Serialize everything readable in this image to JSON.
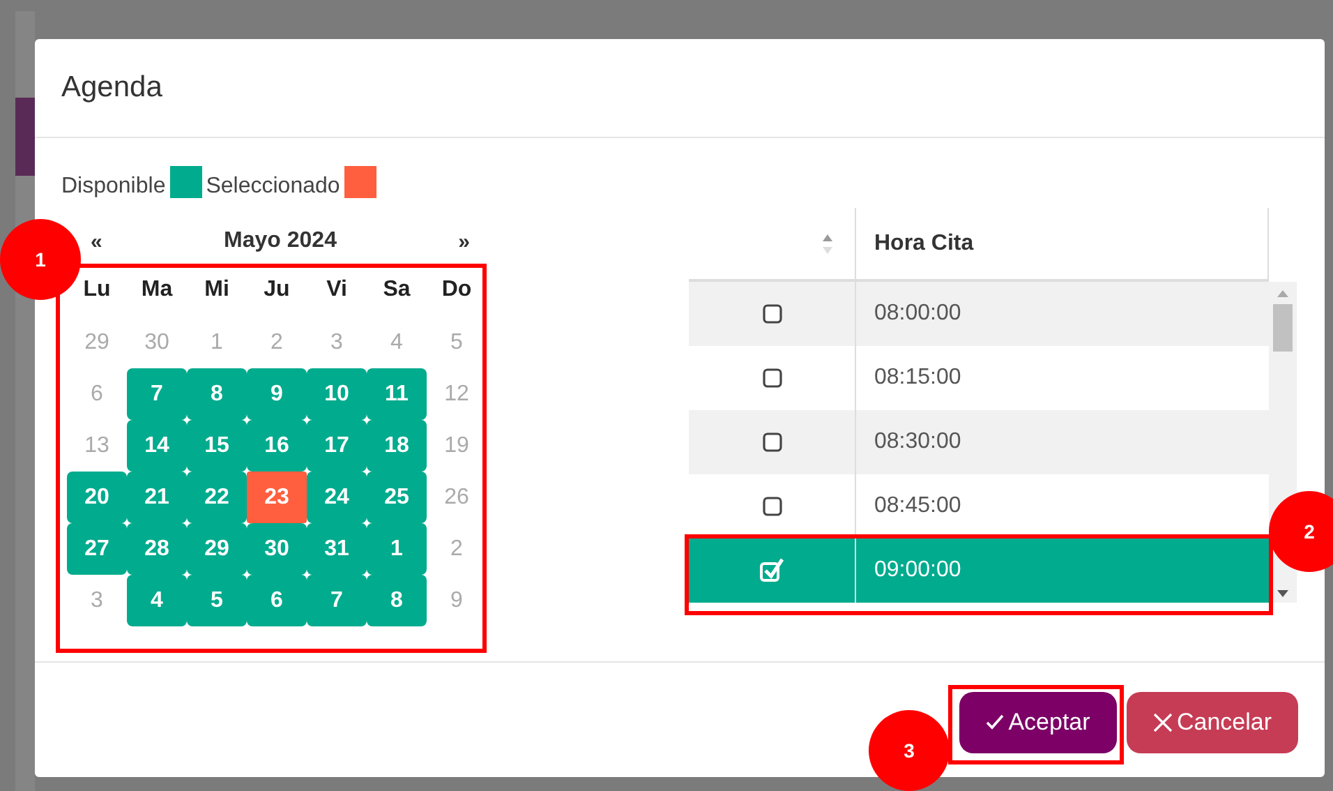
{
  "dialog": {
    "title": "Agenda"
  },
  "legend": [
    {
      "label": "Disponible",
      "color": "#00ab8e"
    },
    {
      "label": "Seleccionado",
      "color": "#ff5f3f"
    }
  ],
  "calendar": {
    "prev": "«",
    "month": "Mayo 2024",
    "next": "»",
    "weekdays": [
      "Lu",
      "Ma",
      "Mi",
      "Ju",
      "Vi",
      "Sa",
      "Do"
    ],
    "weeks": [
      [
        {
          "day": "29",
          "available": false,
          "selected": false
        },
        {
          "day": "30",
          "available": false,
          "selected": false
        },
        {
          "day": "1",
          "available": false,
          "selected": false
        },
        {
          "day": "2",
          "available": false,
          "selected": false
        },
        {
          "day": "3",
          "available": false,
          "selected": false
        },
        {
          "day": "4",
          "available": false,
          "selected": false
        },
        {
          "day": "5",
          "available": false,
          "selected": false
        }
      ],
      [
        {
          "day": "6",
          "available": false,
          "selected": false
        },
        {
          "day": "7",
          "available": true,
          "selected": false
        },
        {
          "day": "8",
          "available": true,
          "selected": false
        },
        {
          "day": "9",
          "available": true,
          "selected": false
        },
        {
          "day": "10",
          "available": true,
          "selected": false
        },
        {
          "day": "11",
          "available": true,
          "selected": false
        },
        {
          "day": "12",
          "available": false,
          "selected": false
        }
      ],
      [
        {
          "day": "13",
          "available": false,
          "selected": false
        },
        {
          "day": "14",
          "available": true,
          "selected": false
        },
        {
          "day": "15",
          "available": true,
          "selected": false
        },
        {
          "day": "16",
          "available": true,
          "selected": false
        },
        {
          "day": "17",
          "available": true,
          "selected": false
        },
        {
          "day": "18",
          "available": true,
          "selected": false
        },
        {
          "day": "19",
          "available": false,
          "selected": false
        }
      ],
      [
        {
          "day": "20",
          "available": true,
          "selected": false
        },
        {
          "day": "21",
          "available": true,
          "selected": false
        },
        {
          "day": "22",
          "available": true,
          "selected": false
        },
        {
          "day": "23",
          "available": true,
          "selected": true
        },
        {
          "day": "24",
          "available": true,
          "selected": false
        },
        {
          "day": "25",
          "available": true,
          "selected": false
        },
        {
          "day": "26",
          "available": false,
          "selected": false
        }
      ],
      [
        {
          "day": "27",
          "available": true,
          "selected": false
        },
        {
          "day": "28",
          "available": true,
          "selected": false
        },
        {
          "day": "29",
          "available": true,
          "selected": false
        },
        {
          "day": "30",
          "available": true,
          "selected": false
        },
        {
          "day": "31",
          "available": true,
          "selected": false
        },
        {
          "day": "1",
          "available": true,
          "selected": false
        },
        {
          "day": "2",
          "available": false,
          "selected": false
        }
      ],
      [
        {
          "day": "3",
          "available": false,
          "selected": false
        },
        {
          "day": "4",
          "available": true,
          "selected": false
        },
        {
          "day": "5",
          "available": true,
          "selected": false
        },
        {
          "day": "6",
          "available": true,
          "selected": false
        },
        {
          "day": "7",
          "available": true,
          "selected": false
        },
        {
          "day": "8",
          "available": true,
          "selected": false
        },
        {
          "day": "9",
          "available": false,
          "selected": false
        }
      ]
    ]
  },
  "table": {
    "columns": [
      "Hora Cita"
    ],
    "rows": [
      {
        "time": "08:00:00",
        "checked": false,
        "selected": false
      },
      {
        "time": "08:15:00",
        "checked": false,
        "selected": false
      },
      {
        "time": "08:30:00",
        "checked": false,
        "selected": false
      },
      {
        "time": "08:45:00",
        "checked": false,
        "selected": false
      },
      {
        "time": "09:00:00",
        "checked": true,
        "selected": true
      }
    ]
  },
  "buttons": [
    {
      "label": "Aceptar",
      "kind": "accept"
    },
    {
      "label": "Cancelar",
      "kind": "cancel"
    }
  ],
  "annotations": [
    "1",
    "2",
    "3"
  ]
}
